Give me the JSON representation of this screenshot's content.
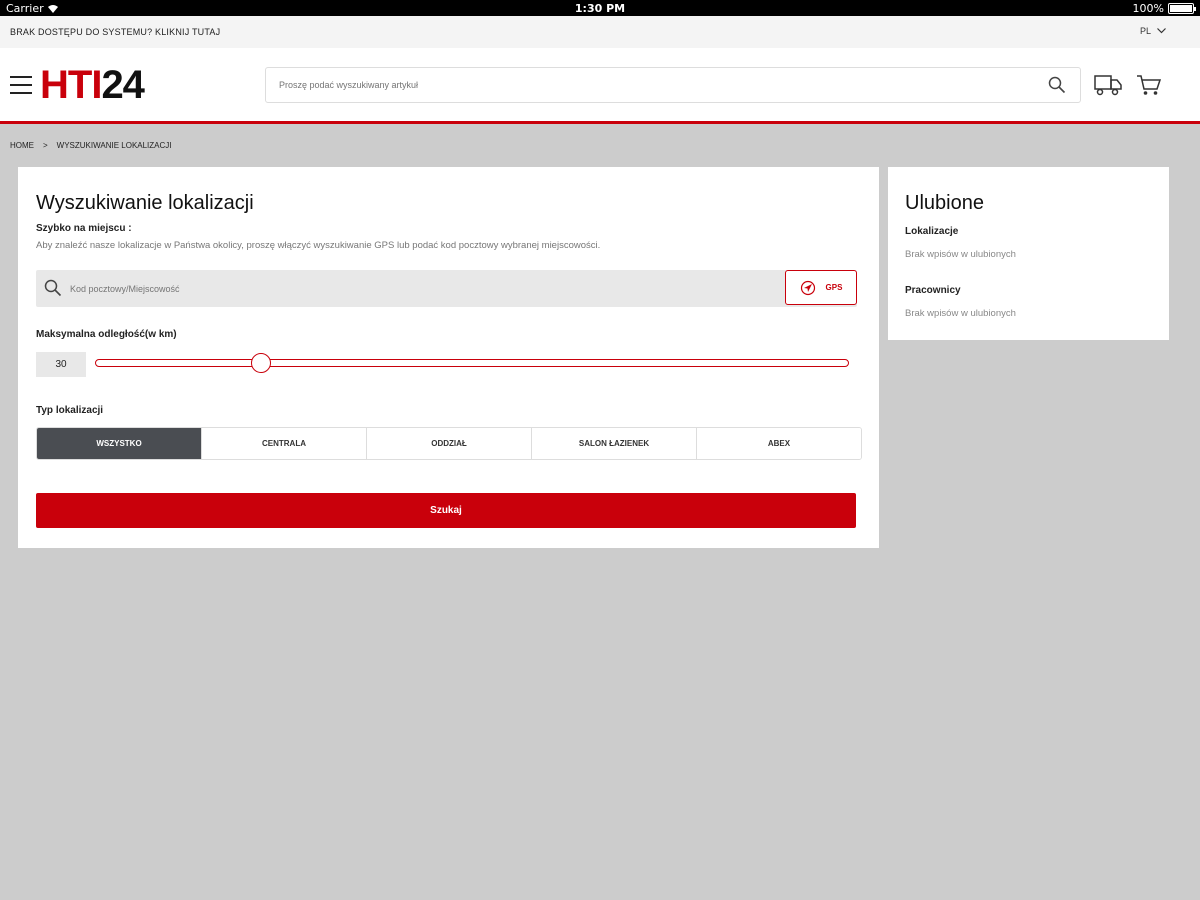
{
  "status_bar": {
    "carrier": "Carrier",
    "time": "1:30 PM",
    "battery": "100%"
  },
  "info_bar": {
    "access_text": "BRAK DOSTĘPU DO SYSTEMU? KLIKNIJ TUTAJ",
    "language": "PL"
  },
  "header": {
    "logo_red": "HTI",
    "logo_black": "24",
    "search_placeholder": "Proszę podać wyszukiwany artykuł"
  },
  "breadcrumb": {
    "home": "HOME",
    "separator": ">",
    "current": "WYSZUKIWANIE LOKALIZACJI"
  },
  "main": {
    "title": "Wyszukiwanie lokalizacji",
    "quick_label": "Szybko na miejscu :",
    "quick_help": "Aby znaleźć nasze lokalizacje w Państwa okolicy, proszę włączyć wyszukiwanie GPS lub podać kod pocztowy wybranej miejscowości.",
    "location_placeholder": "Kod pocztowy/Miejscowość",
    "gps_label": "GPS",
    "distance_label": "Maksymalna odległość(w km)",
    "distance_value": "30",
    "distance_level": 0.22,
    "type_label": "Typ lokalizacji",
    "types": [
      "WSZYSTKO",
      "CENTRALA",
      "ODDZIAŁ",
      "SALON ŁAZIENEK",
      "ABEX"
    ],
    "active_type": "WSZYSTKO",
    "search_button": "Szukaj"
  },
  "favourites": {
    "title": "Ulubione",
    "locations_title": "Lokalizacje",
    "locations_empty": "Brak wpisów w ulubionych",
    "employees_title": "Pracownicy",
    "employees_empty": "Brak wpisów w ulubionych"
  },
  "colors": {
    "brand_red": "#c9000b",
    "active_segment": "#4a4d52",
    "page_bg": "#cccccc"
  }
}
